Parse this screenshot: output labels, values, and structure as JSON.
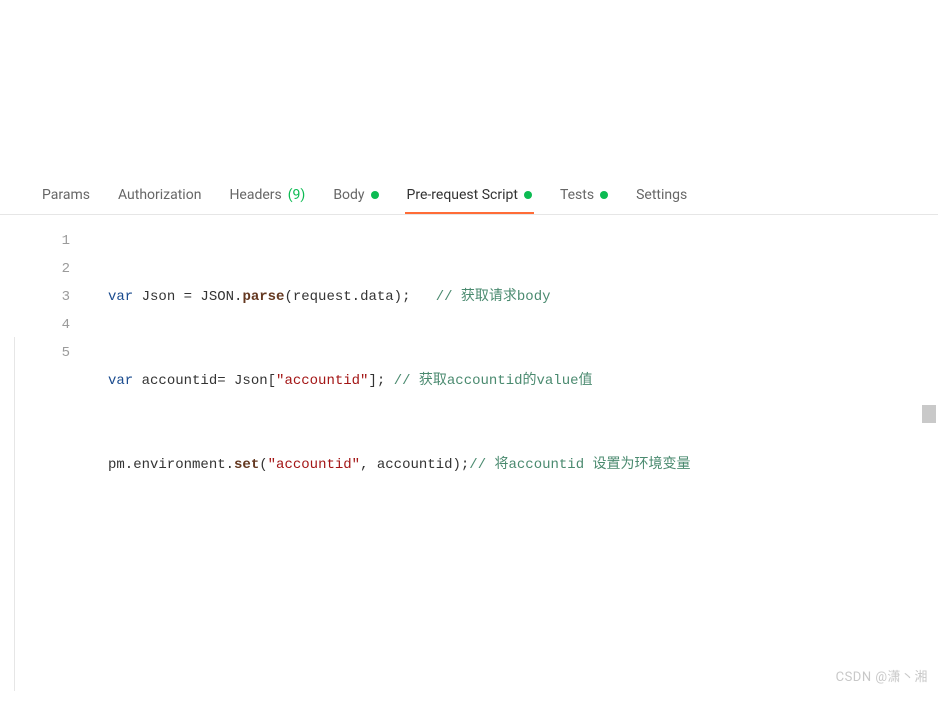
{
  "tabs": {
    "params": "Params",
    "authorization": "Authorization",
    "headers_label": "Headers",
    "headers_count": "(9)",
    "body": "Body",
    "prerequest": "Pre-request Script",
    "tests": "Tests",
    "settings": "Settings"
  },
  "code": {
    "line1_var": "var",
    "line1_a": " Json = JSON.",
    "line1_fn": "parse",
    "line1_b": "(request.data);   ",
    "line1_cmt": "// 获取请求body",
    "line2_var": "var",
    "line2_a": " accountid= Json[",
    "line2_str": "\"accountid\"",
    "line2_b": "]; ",
    "line2_cmt": "// 获取accountid的value值",
    "line3_a": "pm.environment.",
    "line3_fn": "set",
    "line3_b": "(",
    "line3_str": "\"accountid\"",
    "line3_c": ", accountid);",
    "line3_cmt": "// 将accountid 设置为环境变量"
  },
  "gutter": {
    "n1": "1",
    "n2": "2",
    "n3": "3",
    "n4": "4",
    "n5": "5"
  },
  "watermark": "CSDN @潇丶湘"
}
